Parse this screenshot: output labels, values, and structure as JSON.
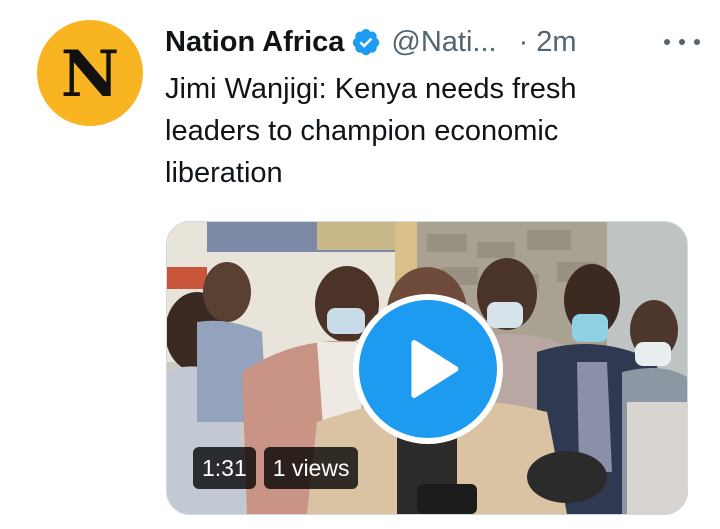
{
  "tweet": {
    "avatar_letter": "N",
    "author_name": "Nation Africa",
    "handle": "@Nati...",
    "separator": "·",
    "time": "2m",
    "text": "Jimi Wanjigi: Kenya needs fresh leaders to champion economic liberation",
    "more_icon": "ellipsis-icon",
    "verified_icon": "verified-badge-icon"
  },
  "media": {
    "duration": "1:31",
    "views": "1 views",
    "play_icon": "play-icon"
  },
  "colors": {
    "avatar_bg": "#f9b421",
    "verified": "#1d9bf0",
    "play_button": "#1d9bf0",
    "secondary_text": "#536471"
  }
}
